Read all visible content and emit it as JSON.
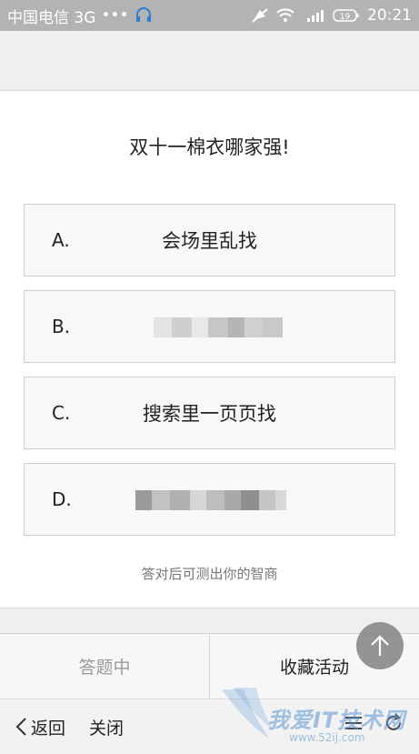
{
  "status_bar": {
    "carrier": "中国电信 3G",
    "dots": "•••",
    "time": "20:21",
    "battery": "19"
  },
  "quiz": {
    "question": "双十一棉衣哪家强!",
    "options": [
      {
        "letter": "A.",
        "text": "会场里乱找"
      },
      {
        "letter": "B.",
        "text": ""
      },
      {
        "letter": "C.",
        "text": "搜索里一页页找"
      },
      {
        "letter": "D.",
        "text": ""
      }
    ],
    "hint": "答对后可测出你的智商"
  },
  "action_bar": {
    "left_label": "答题中",
    "right_label": "收藏活动"
  },
  "browser_bar": {
    "back_label": "返回",
    "close_label": "关闭"
  },
  "watermark": {
    "text": "我爱IT技术网",
    "url": "www.52ij.com"
  }
}
